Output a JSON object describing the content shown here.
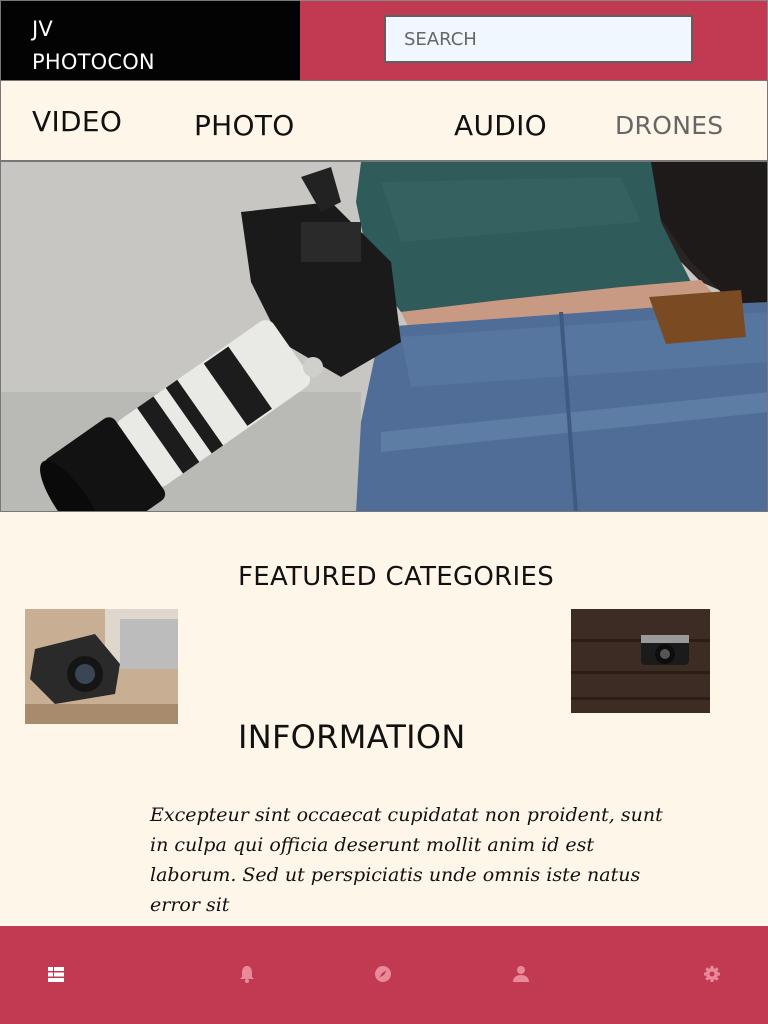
{
  "header": {
    "logo_line1": "JV",
    "logo_line2": "PHOTOCON",
    "search_placeholder": "SEARCH"
  },
  "nav": {
    "items": [
      {
        "label": "VIDEO"
      },
      {
        "label": "PHOTO"
      },
      {
        "label": "AUDIO"
      },
      {
        "label": "DRONES"
      }
    ]
  },
  "featured": {
    "title": "FEATURED CATEGORIES"
  },
  "information": {
    "title": "INFORMATION",
    "body": "Excepteur sint occaecat cupidatat non proident, sunt in culpa qui officia deserunt mollit anim id est laborum. Sed ut perspiciatis unde omnis iste natus error sit"
  },
  "bottom_nav": {
    "icons": [
      "dashboard-icon",
      "bell-icon",
      "compass-icon",
      "person-icon",
      "gear-icon"
    ]
  },
  "colors": {
    "accent": "#c23a51",
    "background": "#fff6ea",
    "logo_bg": "#030303",
    "search_bg": "#f0f7fe",
    "nav_inactive": "#666666"
  }
}
